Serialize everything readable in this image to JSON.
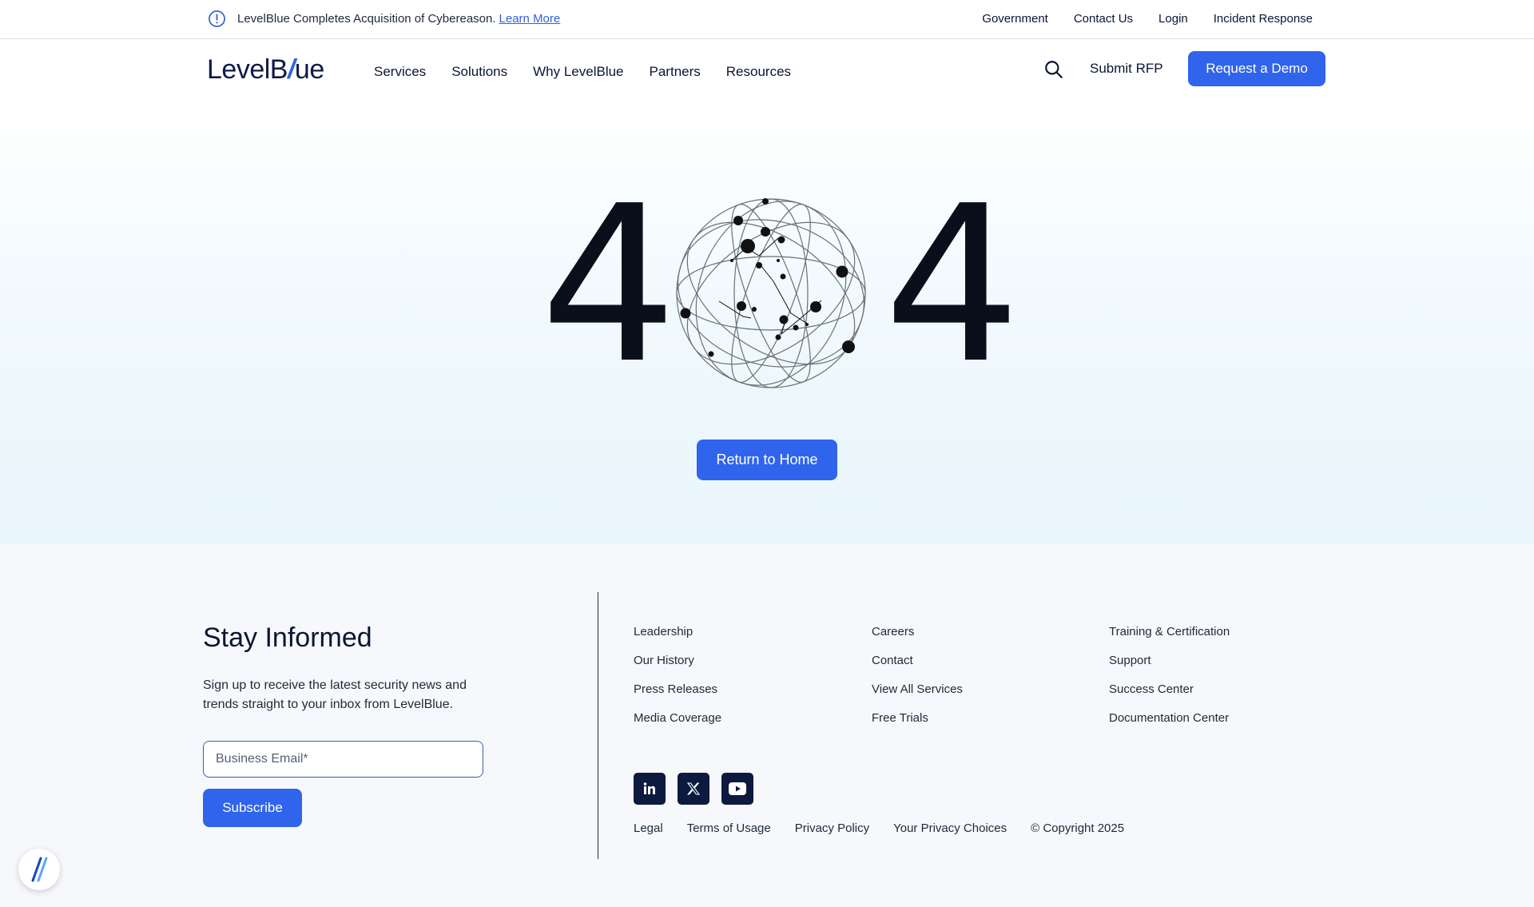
{
  "announcement": {
    "text": "LevelBlue Completes Acquisition of Cybereason.",
    "link": "Learn More"
  },
  "utility_nav": [
    "Government",
    "Contact Us",
    "Login",
    "Incident Response"
  ],
  "brand": {
    "name_part1": "Level",
    "name_b": "B",
    "name_slash": "/",
    "name_part2": "ue",
    "accent": "#2f62f0"
  },
  "main_nav": [
    "Services",
    "Solutions",
    "Why LevelBlue",
    "Partners",
    "Resources"
  ],
  "header_actions": {
    "submit_rfp": "Submit RFP",
    "demo": "Request a Demo"
  },
  "error": {
    "digit_left": "4",
    "digit_right": "4",
    "return_button": "Return to Home"
  },
  "footer": {
    "stay_title": "Stay Informed",
    "stay_text": "Sign up to receive the latest security news and trends straight to your inbox from LevelBlue.",
    "email_placeholder": "Business Email*",
    "subscribe": "Subscribe",
    "col1": [
      "Leadership",
      "Our History",
      "Press Releases",
      "Media Coverage"
    ],
    "col2": [
      "Careers",
      "Contact",
      "View All Services",
      "Free Trials"
    ],
    "col3": [
      "Training & Certification",
      "Support",
      "Success Center",
      "Documentation Center"
    ],
    "socials": [
      "linkedin-icon",
      "x-icon",
      "youtube-icon"
    ],
    "legal": [
      "Legal",
      "Terms of Usage",
      "Privacy Policy",
      "Your Privacy Choices",
      "© Copyright 2025"
    ]
  },
  "colors": {
    "primary": "#3064ec",
    "footer_bg": "#f6f8fb",
    "social_bg": "#0b1a3e"
  }
}
